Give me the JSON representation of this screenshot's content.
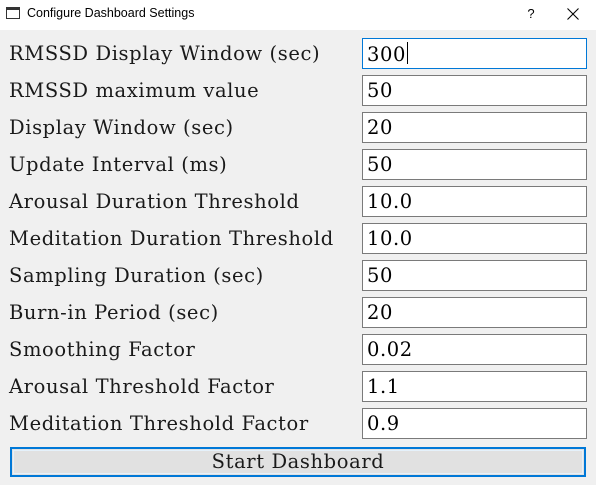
{
  "window": {
    "title": "Configure Dashboard Settings",
    "help_label": "?",
    "icons": {
      "app": "app-icon",
      "close": "close-icon"
    }
  },
  "form": {
    "rows": [
      {
        "label": "RMSSD Display Window (sec)",
        "value": "300",
        "focused": true
      },
      {
        "label": "RMSSD maximum value",
        "value": "50"
      },
      {
        "label": "Display Window (sec)",
        "value": "20"
      },
      {
        "label": "Update Interval (ms)",
        "value": "50"
      },
      {
        "label": "Arousal Duration Threshold",
        "value": "10.0"
      },
      {
        "label": "Meditation Duration Threshold",
        "value": "10.0"
      },
      {
        "label": "Sampling Duration (sec)",
        "value": "50"
      },
      {
        "label": "Burn-in Period (sec)",
        "value": "20"
      },
      {
        "label": "Smoothing Factor",
        "value": "0.02"
      },
      {
        "label": "Arousal Threshold Factor",
        "value": "1.1"
      },
      {
        "label": "Meditation Threshold Factor",
        "value": "0.9"
      }
    ]
  },
  "start_button": {
    "label": "Start Dashboard"
  },
  "colors": {
    "focus": "#0078d7",
    "background": "#f0f0f0",
    "field_border": "#7a7a7a"
  }
}
